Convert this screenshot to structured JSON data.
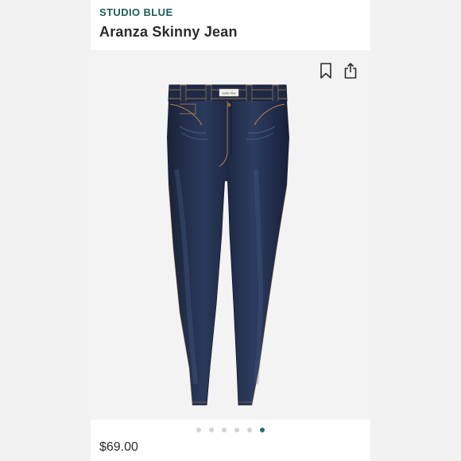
{
  "product": {
    "brand": "STUDIO BLUE",
    "name": "Aranza Skinny Jean",
    "price": "$69.00",
    "label_tag_text": "studio blue"
  },
  "actions": {
    "bookmark_icon": "bookmark-icon",
    "share_icon": "share-icon"
  },
  "carousel": {
    "total": 6,
    "active_index": 5
  },
  "colors": {
    "brand": "#1f5c55",
    "active_dot": "#23716a",
    "denim": "#1c2740",
    "stitching": "#b8874f"
  }
}
